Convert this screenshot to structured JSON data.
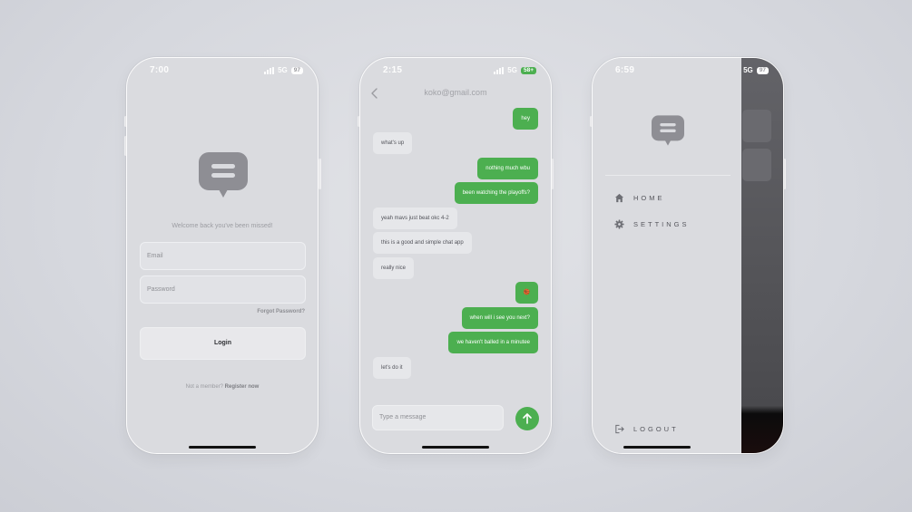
{
  "login_screen": {
    "status": {
      "time": "7:00",
      "network": "5G",
      "battery": "97"
    },
    "welcome_text": "Welcome back you've been missed!",
    "email_placeholder": "Email",
    "password_placeholder": "Password",
    "forgot_password": "Forgot Password?",
    "login_label": "Login",
    "register_prompt": "Not a member?",
    "register_link": "Register now"
  },
  "chat_screen": {
    "status": {
      "time": "2:15",
      "network": "5G",
      "battery": "58+"
    },
    "title": "koko@gmail.com",
    "messages": [
      {
        "side": "out",
        "text": "hey"
      },
      {
        "side": "in",
        "text": "what's up"
      },
      {
        "side": "out",
        "text": "nothing much wbu"
      },
      {
        "side": "out",
        "text": "been watching the playoffs?"
      },
      {
        "side": "in",
        "text": "yeah mavs just beat okc 4-2"
      },
      {
        "side": "in",
        "text": "this is a good and simple chat app"
      },
      {
        "side": "in",
        "text": "really nice"
      },
      {
        "side": "out",
        "text": "🏀"
      },
      {
        "side": "out",
        "text": "when will i see you next?"
      },
      {
        "side": "out",
        "text": "we haven't balled in a minutee"
      },
      {
        "side": "in",
        "text": "let's do it"
      }
    ],
    "input_placeholder": "Type a message"
  },
  "menu_screen": {
    "status": {
      "time": "6:59",
      "network": "5G",
      "battery": "97"
    },
    "items": [
      {
        "label": "HOME",
        "icon": "home-icon"
      },
      {
        "label": "SETTINGS",
        "icon": "gear-icon"
      }
    ],
    "logout_label": "LOGOUT"
  },
  "colors": {
    "accent_green": "#4caf50",
    "logo_gray": "#8e8e94"
  }
}
